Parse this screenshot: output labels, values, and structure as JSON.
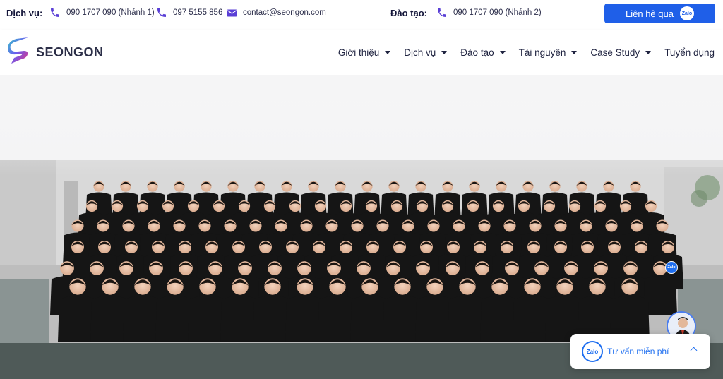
{
  "topbar": {
    "services_label": "Dịch vụ:",
    "phone_branch1": "090 1707 090 (Nhánh 1)",
    "phone_main": "097 5155 856",
    "email": "contact@seongon.com",
    "training_label": "Đào tạo:",
    "training_phone": "090 1707 090 (Nhánh 2)",
    "cta_label": "Liên hệ qua",
    "cta_badge": "Zalo"
  },
  "brand": {
    "name": "SEONGON"
  },
  "nav": {
    "items": [
      {
        "label": "Giới thiệu",
        "has_dropdown": true
      },
      {
        "label": "Dịch vụ",
        "has_dropdown": true
      },
      {
        "label": "Đào tạo",
        "has_dropdown": true
      },
      {
        "label": "Tài nguyên",
        "has_dropdown": true
      },
      {
        "label": "Case Study",
        "has_dropdown": true
      },
      {
        "label": "Tuyển dụng",
        "has_dropdown": false
      }
    ]
  },
  "widgets": {
    "avatar_badge": "Zalo",
    "consult_icon": "Zalo",
    "consult_label": "Tư vấn miễn phí"
  },
  "colors": {
    "primary": "#1f5fe8",
    "icon": "#5a3fd6",
    "text": "#1f2340",
    "logo_pink": "#e8307a",
    "logo_teal": "#36c6c8"
  },
  "icons": [
    "phone-icon",
    "mail-icon",
    "zalo-icon",
    "caret-down-icon",
    "chevron-up-icon"
  ]
}
